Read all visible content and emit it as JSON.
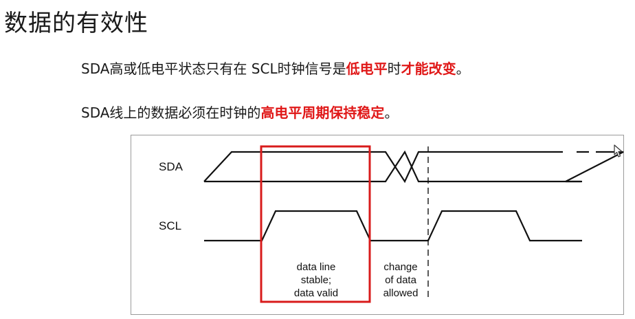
{
  "slide": {
    "title": "数据的有效性"
  },
  "text_lines": [
    {
      "parts": [
        {
          "text": "SDA高或低电平状态只有在 SCL时钟信号是",
          "highlight": false
        },
        {
          "text": "低电平",
          "highlight": true
        },
        {
          "text": "时",
          "highlight": false
        },
        {
          "text": "才能改变",
          "highlight": true
        },
        {
          "text": "。",
          "highlight": false
        }
      ]
    },
    {
      "parts": [
        {
          "text": "SDA线上的数据必须在时钟的",
          "highlight": false
        },
        {
          "text": "高电平周期保持稳定",
          "highlight": true
        },
        {
          "text": "。",
          "highlight": false
        }
      ]
    }
  ],
  "diagram": {
    "sda_label": "SDA",
    "scl_label": "SCL",
    "caption_stable": [
      "data line",
      "stable;",
      "data valid"
    ],
    "caption_change": [
      "change",
      "of data",
      "allowed"
    ]
  },
  "colors": {
    "highlight": "#e01818",
    "valid_window": "#d81b1b",
    "trace": "#111111"
  },
  "icons": {
    "cursor": "mouse-pointer-icon"
  }
}
